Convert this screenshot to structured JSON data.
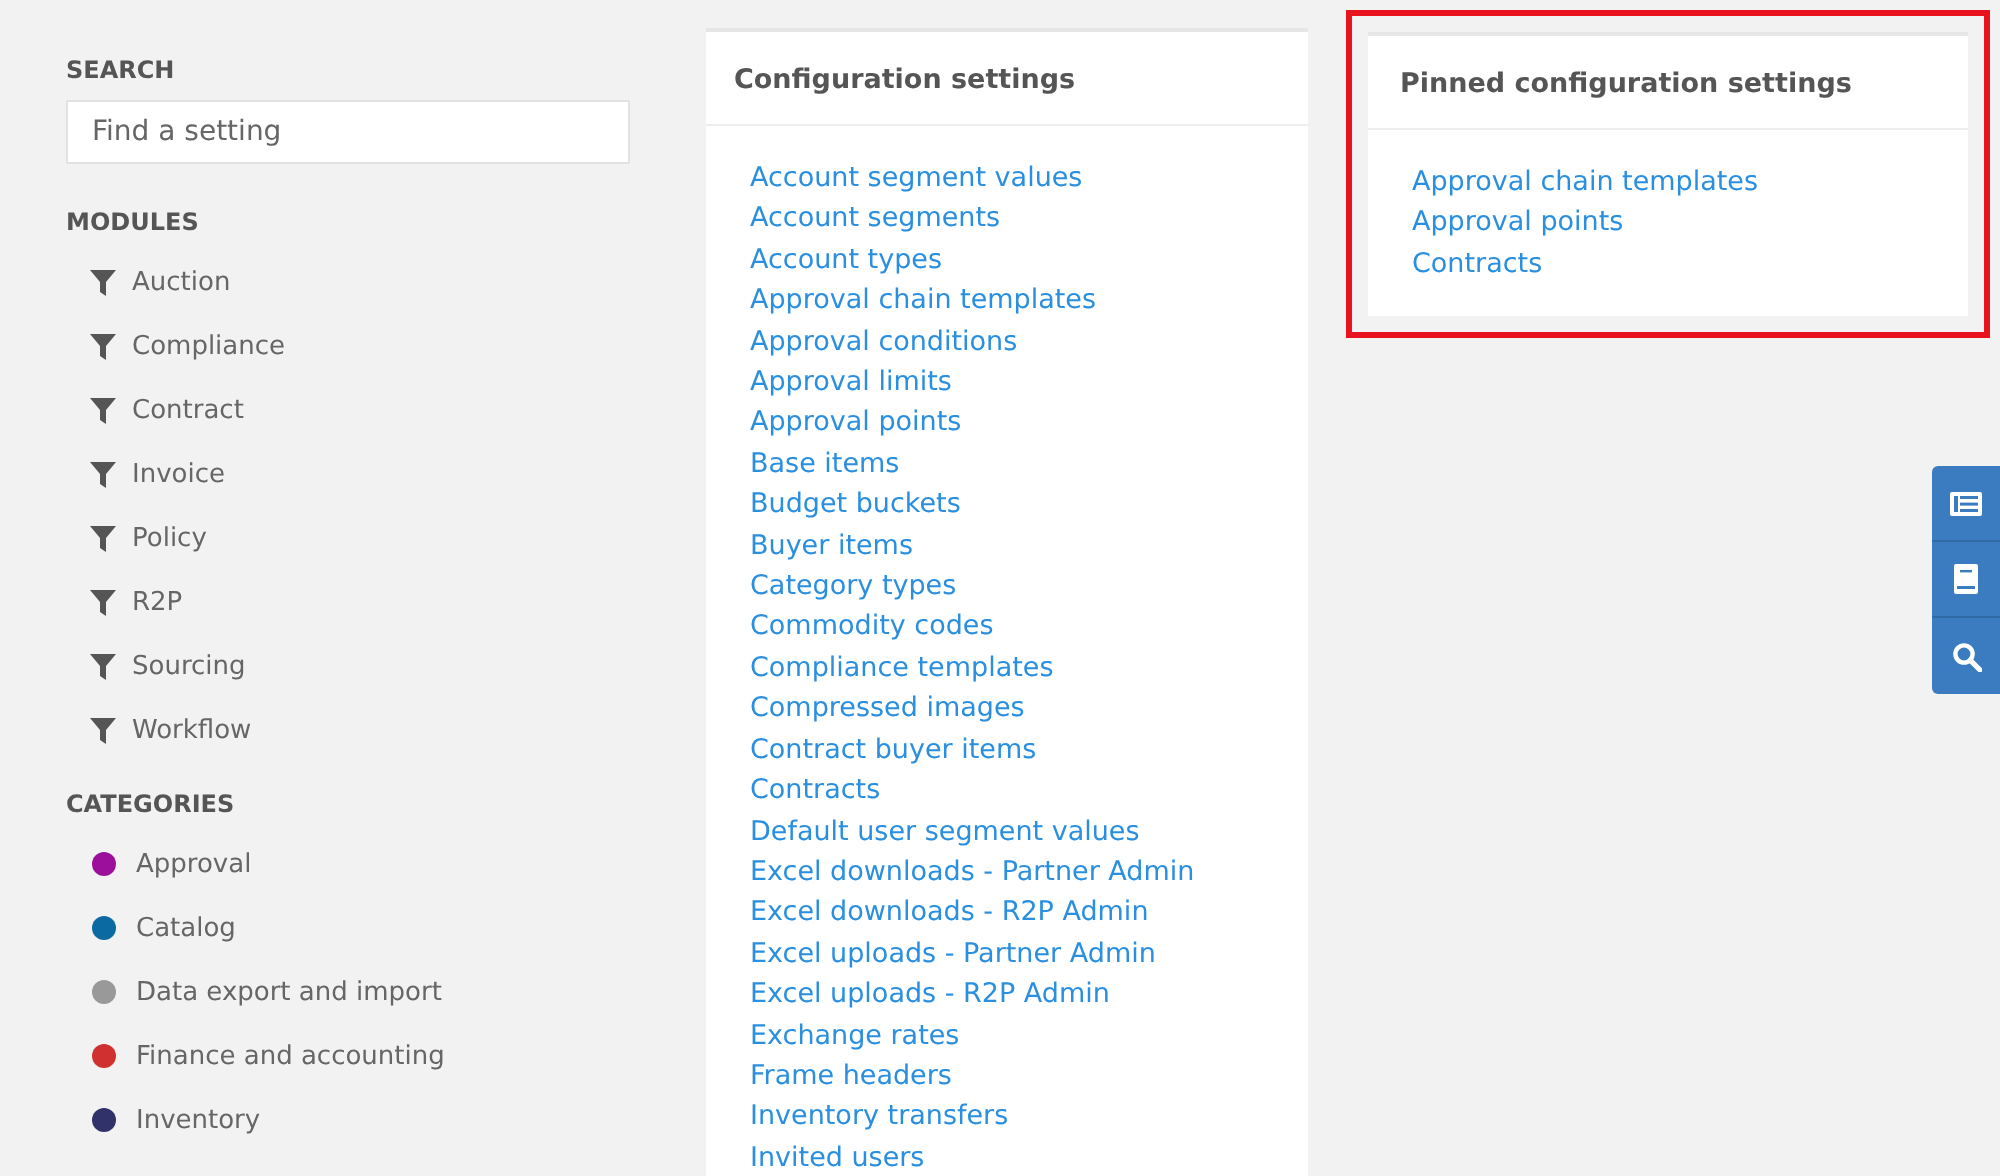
{
  "sidebar": {
    "search_label": "SEARCH",
    "search": {
      "placeholder": "Find a setting"
    },
    "modules_label": "MODULES",
    "modules": [
      {
        "label": "Auction"
      },
      {
        "label": "Compliance"
      },
      {
        "label": "Contract"
      },
      {
        "label": "Invoice"
      },
      {
        "label": "Policy"
      },
      {
        "label": "R2P"
      },
      {
        "label": "Sourcing"
      },
      {
        "label": "Workflow"
      }
    ],
    "categories_label": "CATEGORIES",
    "categories": [
      {
        "label": "Approval",
        "color": "#9c0f9c"
      },
      {
        "label": "Catalog",
        "color": "#0a6aa1"
      },
      {
        "label": "Data export and import",
        "color": "#999999"
      },
      {
        "label": "Finance and accounting",
        "color": "#d03030"
      },
      {
        "label": "Inventory",
        "color": "#32326a"
      }
    ]
  },
  "configuration": {
    "title": "Configuration settings",
    "links": [
      "Account segment values",
      "Account segments",
      "Account types",
      "Approval chain templates",
      "Approval conditions",
      "Approval limits",
      "Approval points",
      "Base items",
      "Budget buckets",
      "Buyer items",
      "Category types",
      "Commodity codes",
      "Compliance templates",
      "Compressed images",
      "Contract buyer items",
      "Contracts",
      "Default user segment values",
      "Excel downloads - Partner Admin",
      "Excel downloads - R2P Admin",
      "Excel uploads - Partner Admin",
      "Excel uploads - R2P Admin",
      "Exchange rates",
      "Frame headers",
      "Inventory transfers",
      "Invited users"
    ]
  },
  "pinned": {
    "title": "Pinned configuration settings",
    "highlighted": true,
    "links": [
      "Approval chain templates",
      "Approval points",
      "Contracts"
    ]
  },
  "side_tabs": [
    {
      "kind": "list"
    },
    {
      "kind": "book"
    },
    {
      "kind": "search"
    }
  ]
}
